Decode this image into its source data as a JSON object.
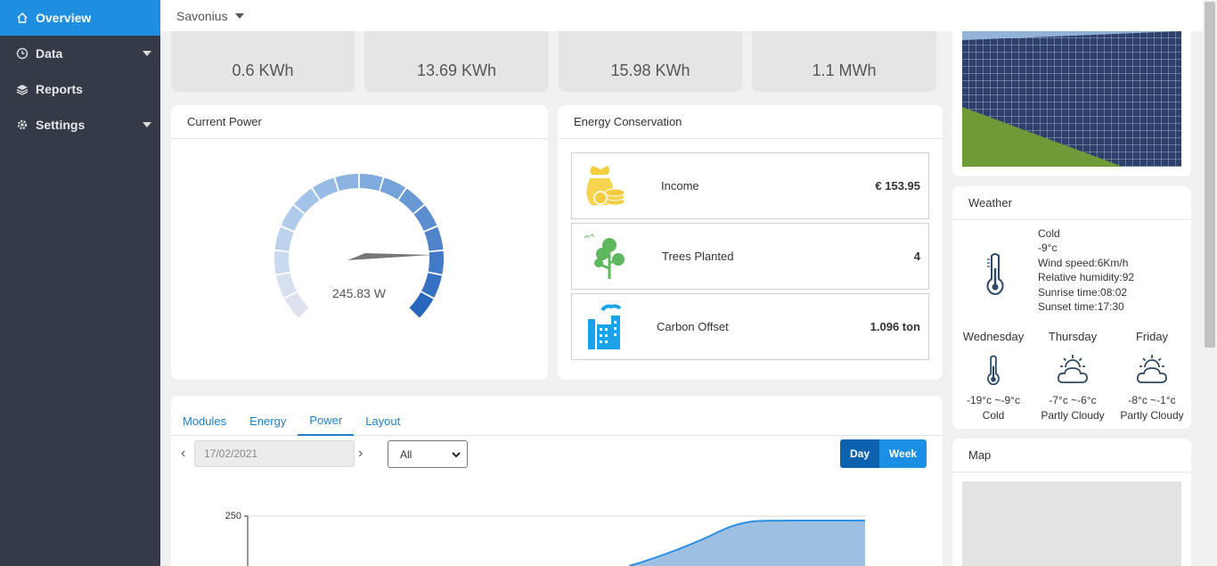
{
  "sidebar": {
    "items": [
      {
        "label": "Overview"
      },
      {
        "label": "Data"
      },
      {
        "label": "Reports"
      },
      {
        "label": "Settings"
      }
    ]
  },
  "topbar": {
    "site_name": "Savonius"
  },
  "stats": [
    "0.6 KWh",
    "13.69 KWh",
    "15.98 KWh",
    "1.1 MWh"
  ],
  "current_power": {
    "title": "Current Power",
    "value": "245.83 W"
  },
  "energy_conservation": {
    "title": "Energy Conservation",
    "rows": [
      {
        "label": "Income",
        "value": "€ 153.95",
        "icon": "money-bag-icon"
      },
      {
        "label": "Trees Planted",
        "value": "4",
        "icon": "tree-icon"
      },
      {
        "label": "Carbon Offset",
        "value": "1.096 ton",
        "icon": "factory-icon"
      }
    ]
  },
  "weather": {
    "title": "Weather",
    "current": [
      "Cold",
      "-9°c",
      "Wind speed:6Km/h",
      "Relative humidity:92",
      "Sunrise time:08:02",
      "Sunset time:17:30"
    ],
    "forecast": [
      {
        "day": "Wednesday",
        "temp": "-19°c ~-9°c",
        "condition": "Cold",
        "icon": "thermometer-icon"
      },
      {
        "day": "Thursday",
        "temp": "-7°c ~-6°c",
        "condition": "Partly Cloudy",
        "icon": "partly-cloudy-icon"
      },
      {
        "day": "Friday",
        "temp": "-8°c ~-1°c",
        "condition": "Partly Cloudy",
        "icon": "partly-cloudy-icon"
      }
    ]
  },
  "map": {
    "title": "Map"
  },
  "power_panel": {
    "tabs": [
      "Modules",
      "Energy",
      "Power",
      "Layout"
    ],
    "active_tab": "Power",
    "date": "17/02/2021",
    "filter": "All",
    "day_label": "Day",
    "week_label": "Week"
  },
  "chart_data": {
    "type": "area",
    "y_tick_labels": [
      "250"
    ],
    "color": "#5b9bd5"
  },
  "colors": {
    "accent": "#1e8fe0",
    "sidebar": "#343a46",
    "active_button": "#0d62b0",
    "inactive_button": "#1a8fe3"
  }
}
